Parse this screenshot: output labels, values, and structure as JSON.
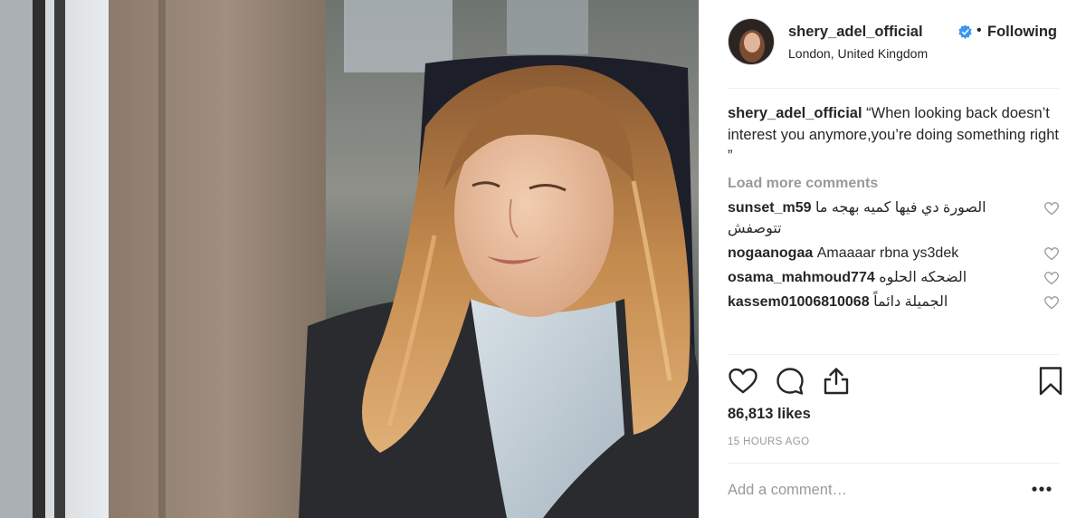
{
  "post": {
    "username": "shery_adel_official",
    "follow_state": "Following",
    "location": "London, United Kingdom",
    "caption": "“When looking back doesn’t interest you anymore,you’re doing something right ”",
    "load_more": "Load more comments",
    "comments": [
      {
        "user": "sunset_m59",
        "text": "الصورة دي فيها كميه بهجه ما تتوصفش"
      },
      {
        "user": "nogaanogaa",
        "text": "Amaaaar rbna ys3dek"
      },
      {
        "user": "osama_mahmoud774",
        "text": "الضحكه الحلوه"
      },
      {
        "user": "kassem01006810068",
        "text": "الجميلة دائماً"
      }
    ],
    "likes": "86,813 likes",
    "time": "15 HOURS AGO",
    "add_comment_placeholder": "Add a comment…"
  },
  "colors": {
    "verified": "#3897f0",
    "text": "#262626",
    "muted": "#999999",
    "divider": "#efefef"
  },
  "icons": {
    "verified": "verified-badge-icon",
    "like": "heart-outline-icon",
    "comment": "speech-bubble-icon",
    "share": "share-upload-icon",
    "save": "bookmark-icon",
    "comment_like": "small-heart-icon",
    "more": "ellipsis-icon"
  }
}
